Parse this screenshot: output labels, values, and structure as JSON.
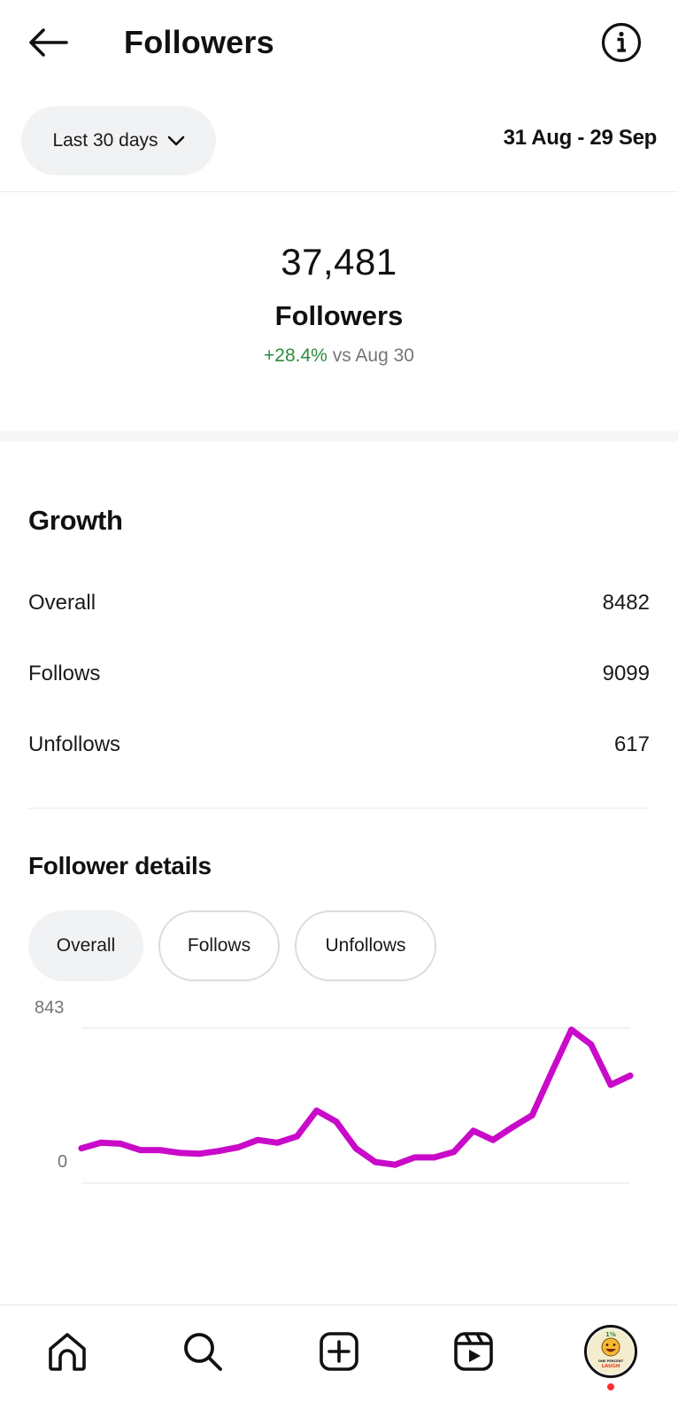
{
  "header": {
    "title": "Followers",
    "back_icon": "arrow-left-icon",
    "info_icon": "info-icon"
  },
  "range": {
    "selected": "Last 30 days",
    "dates": "31 Aug - 29 Sep"
  },
  "summary": {
    "count": "37,481",
    "label": "Followers",
    "change": "+28.4%",
    "compare": "vs Aug 30"
  },
  "growth": {
    "title": "Growth",
    "rows": [
      {
        "label": "Overall",
        "value": "8482"
      },
      {
        "label": "Follows",
        "value": "9099"
      },
      {
        "label": "Unfollows",
        "value": "617"
      }
    ]
  },
  "details": {
    "title": "Follower details",
    "filters": [
      "Overall",
      "Follows",
      "Unfollows"
    ],
    "active_filter": "Overall"
  },
  "chart_data": {
    "type": "line",
    "title": "",
    "xlabel": "",
    "ylabel": "",
    "y_tick_labels": [
      "843",
      "0"
    ],
    "ylim": [
      0,
      843
    ],
    "grid": true,
    "color": "#c90ac9",
    "series": [
      {
        "values": [
          190,
          220,
          215,
          180,
          180,
          165,
          160,
          175,
          195,
          235,
          220,
          255,
          395,
          335,
          190,
          115,
          100,
          140,
          140,
          170,
          285,
          235,
          305,
          370,
          605,
          835,
          755,
          535,
          585
        ]
      }
    ]
  },
  "tabbar": {
    "items": [
      "home-icon",
      "search-icon",
      "create-icon",
      "reels-icon",
      "profile-avatar"
    ],
    "avatar_text": "ONE PERCENT LAUGH"
  },
  "colors": {
    "positive": "#2e8b3e",
    "muted": "#757575",
    "line": "#c90ac9"
  }
}
